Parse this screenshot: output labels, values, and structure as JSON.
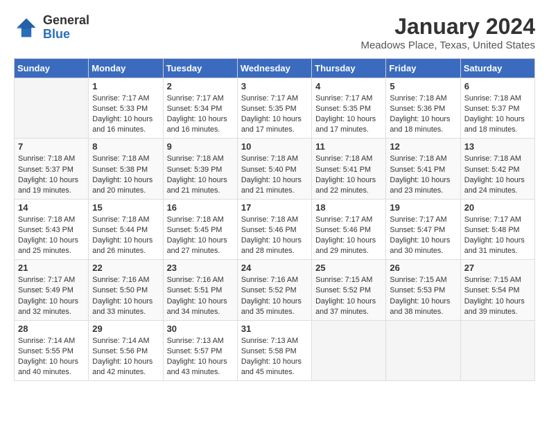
{
  "header": {
    "title": "January 2024",
    "subtitle": "Meadows Place, Texas, United States",
    "logo_general": "General",
    "logo_blue": "Blue"
  },
  "weekdays": [
    "Sunday",
    "Monday",
    "Tuesday",
    "Wednesday",
    "Thursday",
    "Friday",
    "Saturday"
  ],
  "weeks": [
    [
      {
        "day": "",
        "sunrise": "",
        "sunset": "",
        "daylight": ""
      },
      {
        "day": "1",
        "sunrise": "Sunrise: 7:17 AM",
        "sunset": "Sunset: 5:33 PM",
        "daylight": "Daylight: 10 hours and 16 minutes."
      },
      {
        "day": "2",
        "sunrise": "Sunrise: 7:17 AM",
        "sunset": "Sunset: 5:34 PM",
        "daylight": "Daylight: 10 hours and 16 minutes."
      },
      {
        "day": "3",
        "sunrise": "Sunrise: 7:17 AM",
        "sunset": "Sunset: 5:35 PM",
        "daylight": "Daylight: 10 hours and 17 minutes."
      },
      {
        "day": "4",
        "sunrise": "Sunrise: 7:17 AM",
        "sunset": "Sunset: 5:35 PM",
        "daylight": "Daylight: 10 hours and 17 minutes."
      },
      {
        "day": "5",
        "sunrise": "Sunrise: 7:18 AM",
        "sunset": "Sunset: 5:36 PM",
        "daylight": "Daylight: 10 hours and 18 minutes."
      },
      {
        "day": "6",
        "sunrise": "Sunrise: 7:18 AM",
        "sunset": "Sunset: 5:37 PM",
        "daylight": "Daylight: 10 hours and 18 minutes."
      }
    ],
    [
      {
        "day": "7",
        "sunrise": "Sunrise: 7:18 AM",
        "sunset": "Sunset: 5:37 PM",
        "daylight": "Daylight: 10 hours and 19 minutes."
      },
      {
        "day": "8",
        "sunrise": "Sunrise: 7:18 AM",
        "sunset": "Sunset: 5:38 PM",
        "daylight": "Daylight: 10 hours and 20 minutes."
      },
      {
        "day": "9",
        "sunrise": "Sunrise: 7:18 AM",
        "sunset": "Sunset: 5:39 PM",
        "daylight": "Daylight: 10 hours and 21 minutes."
      },
      {
        "day": "10",
        "sunrise": "Sunrise: 7:18 AM",
        "sunset": "Sunset: 5:40 PM",
        "daylight": "Daylight: 10 hours and 21 minutes."
      },
      {
        "day": "11",
        "sunrise": "Sunrise: 7:18 AM",
        "sunset": "Sunset: 5:41 PM",
        "daylight": "Daylight: 10 hours and 22 minutes."
      },
      {
        "day": "12",
        "sunrise": "Sunrise: 7:18 AM",
        "sunset": "Sunset: 5:41 PM",
        "daylight": "Daylight: 10 hours and 23 minutes."
      },
      {
        "day": "13",
        "sunrise": "Sunrise: 7:18 AM",
        "sunset": "Sunset: 5:42 PM",
        "daylight": "Daylight: 10 hours and 24 minutes."
      }
    ],
    [
      {
        "day": "14",
        "sunrise": "Sunrise: 7:18 AM",
        "sunset": "Sunset: 5:43 PM",
        "daylight": "Daylight: 10 hours and 25 minutes."
      },
      {
        "day": "15",
        "sunrise": "Sunrise: 7:18 AM",
        "sunset": "Sunset: 5:44 PM",
        "daylight": "Daylight: 10 hours and 26 minutes."
      },
      {
        "day": "16",
        "sunrise": "Sunrise: 7:18 AM",
        "sunset": "Sunset: 5:45 PM",
        "daylight": "Daylight: 10 hours and 27 minutes."
      },
      {
        "day": "17",
        "sunrise": "Sunrise: 7:18 AM",
        "sunset": "Sunset: 5:46 PM",
        "daylight": "Daylight: 10 hours and 28 minutes."
      },
      {
        "day": "18",
        "sunrise": "Sunrise: 7:17 AM",
        "sunset": "Sunset: 5:46 PM",
        "daylight": "Daylight: 10 hours and 29 minutes."
      },
      {
        "day": "19",
        "sunrise": "Sunrise: 7:17 AM",
        "sunset": "Sunset: 5:47 PM",
        "daylight": "Daylight: 10 hours and 30 minutes."
      },
      {
        "day": "20",
        "sunrise": "Sunrise: 7:17 AM",
        "sunset": "Sunset: 5:48 PM",
        "daylight": "Daylight: 10 hours and 31 minutes."
      }
    ],
    [
      {
        "day": "21",
        "sunrise": "Sunrise: 7:17 AM",
        "sunset": "Sunset: 5:49 PM",
        "daylight": "Daylight: 10 hours and 32 minutes."
      },
      {
        "day": "22",
        "sunrise": "Sunrise: 7:16 AM",
        "sunset": "Sunset: 5:50 PM",
        "daylight": "Daylight: 10 hours and 33 minutes."
      },
      {
        "day": "23",
        "sunrise": "Sunrise: 7:16 AM",
        "sunset": "Sunset: 5:51 PM",
        "daylight": "Daylight: 10 hours and 34 minutes."
      },
      {
        "day": "24",
        "sunrise": "Sunrise: 7:16 AM",
        "sunset": "Sunset: 5:52 PM",
        "daylight": "Daylight: 10 hours and 35 minutes."
      },
      {
        "day": "25",
        "sunrise": "Sunrise: 7:15 AM",
        "sunset": "Sunset: 5:52 PM",
        "daylight": "Daylight: 10 hours and 37 minutes."
      },
      {
        "day": "26",
        "sunrise": "Sunrise: 7:15 AM",
        "sunset": "Sunset: 5:53 PM",
        "daylight": "Daylight: 10 hours and 38 minutes."
      },
      {
        "day": "27",
        "sunrise": "Sunrise: 7:15 AM",
        "sunset": "Sunset: 5:54 PM",
        "daylight": "Daylight: 10 hours and 39 minutes."
      }
    ],
    [
      {
        "day": "28",
        "sunrise": "Sunrise: 7:14 AM",
        "sunset": "Sunset: 5:55 PM",
        "daylight": "Daylight: 10 hours and 40 minutes."
      },
      {
        "day": "29",
        "sunrise": "Sunrise: 7:14 AM",
        "sunset": "Sunset: 5:56 PM",
        "daylight": "Daylight: 10 hours and 42 minutes."
      },
      {
        "day": "30",
        "sunrise": "Sunrise: 7:13 AM",
        "sunset": "Sunset: 5:57 PM",
        "daylight": "Daylight: 10 hours and 43 minutes."
      },
      {
        "day": "31",
        "sunrise": "Sunrise: 7:13 AM",
        "sunset": "Sunset: 5:58 PM",
        "daylight": "Daylight: 10 hours and 45 minutes."
      },
      {
        "day": "",
        "sunrise": "",
        "sunset": "",
        "daylight": ""
      },
      {
        "day": "",
        "sunrise": "",
        "sunset": "",
        "daylight": ""
      },
      {
        "day": "",
        "sunrise": "",
        "sunset": "",
        "daylight": ""
      }
    ]
  ]
}
